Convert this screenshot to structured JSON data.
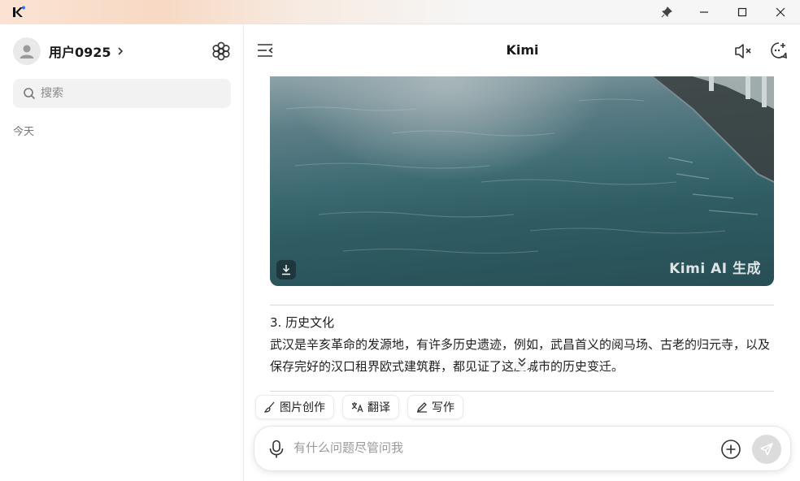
{
  "app": {
    "window_title": "Kimi"
  },
  "sidebar": {
    "username": "用户0925",
    "search_placeholder": "搜索",
    "section_today": "今天"
  },
  "main": {
    "title": "Kimi",
    "image_card": {
      "watermark": "Kimi AI 生成"
    },
    "message": {
      "heading": "3. 历史文化",
      "body": "武汉是辛亥革命的发源地，有许多历史遗迹，例如，武昌首义的阅马场、古老的归元寺，以及保存完好的汉口租界欧式建筑群，都见证了这座城市的历史变迁。"
    },
    "chips": [
      {
        "label": "图片创作",
        "icon": "brush-icon"
      },
      {
        "label": "翻译",
        "icon": "translate-icon"
      },
      {
        "label": "写作",
        "icon": "pen-icon"
      }
    ],
    "composer": {
      "placeholder": "有什么问题尽管问我"
    }
  },
  "colors": {
    "accent": "#1f1f1f",
    "sidebar_search_bg": "#f2f2f2",
    "send_disabled": "#dcdcdc"
  }
}
